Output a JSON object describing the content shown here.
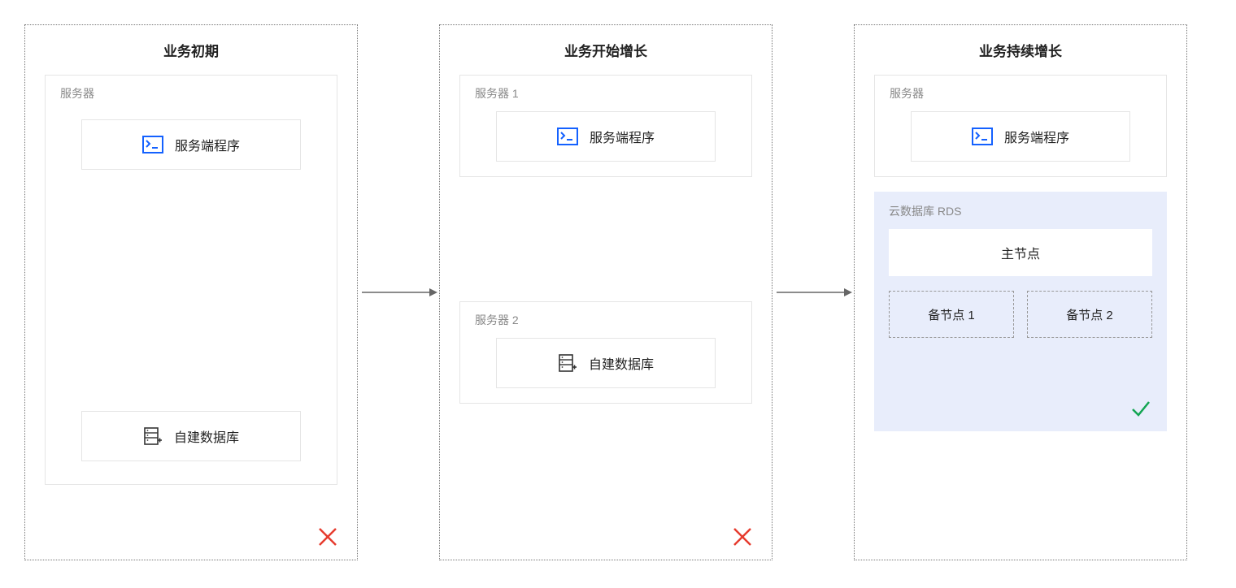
{
  "panels": {
    "p1": {
      "title": "业务初期",
      "group_label": "服务器",
      "app_node": "服务端程序",
      "db_node": "自建数据库",
      "status": "fail"
    },
    "p2": {
      "title": "业务开始增长",
      "group1_label": "服务器 1",
      "group2_label": "服务器 2",
      "app_node": "服务端程序",
      "db_node": "自建数据库",
      "status": "fail"
    },
    "p3": {
      "title": "业务持续增长",
      "group_label": "服务器",
      "app_node": "服务端程序",
      "rds_label": "云数据库 RDS",
      "main_node": "主节点",
      "sub1": "备节点 1",
      "sub2": "备节点 2",
      "status": "ok"
    }
  }
}
